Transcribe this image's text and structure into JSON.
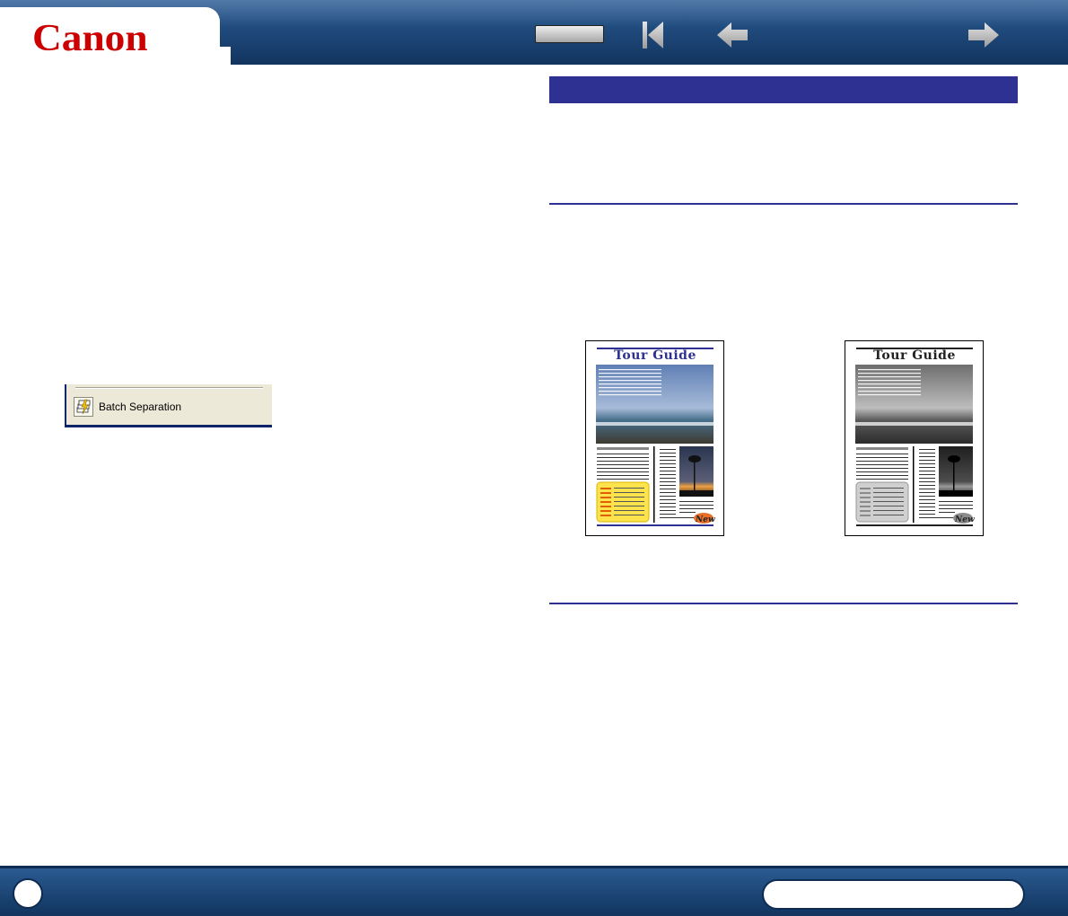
{
  "header": {
    "logo_text": "Canon",
    "toc_button_label": "",
    "first_page_icon": "skip-to-first-icon",
    "back_icon": "arrow-left-icon",
    "next_icon": "arrow-right-icon"
  },
  "left_column": {
    "toolbar": {
      "batch_separation_label": "Batch Separation",
      "batch_separation_icon": "batch-separation-icon"
    }
  },
  "right_column": {
    "section_title": "",
    "examples": [
      {
        "variant": "color",
        "title": "Tour Guide",
        "badge": "New"
      },
      {
        "variant": "grayscale",
        "title": "Tour Guide",
        "badge": "New"
      }
    ]
  },
  "footer": {
    "page_number": "",
    "label": ""
  },
  "colors": {
    "brand_red": "#cc0000",
    "header_blue": "#1d4677",
    "section_blue": "#2e3191",
    "toolbar_bg": "#ece9d8"
  }
}
